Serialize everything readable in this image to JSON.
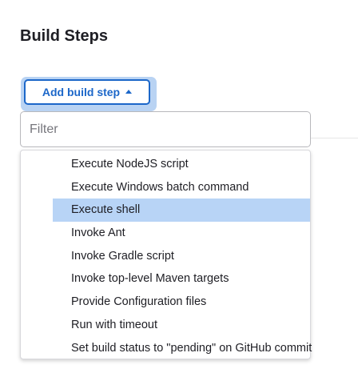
{
  "section": {
    "title": "Build Steps"
  },
  "add_step_button": {
    "label": "Add build step",
    "icon": "caret-up-icon"
  },
  "filter": {
    "placeholder": "Filter",
    "value": ""
  },
  "menu": {
    "highlighted_index": 2,
    "items": [
      {
        "label": "Execute NodeJS script"
      },
      {
        "label": "Execute Windows batch command"
      },
      {
        "label": "Execute shell"
      },
      {
        "label": "Invoke Ant"
      },
      {
        "label": "Invoke Gradle script"
      },
      {
        "label": "Invoke top-level Maven targets"
      },
      {
        "label": "Provide Configuration files"
      },
      {
        "label": "Run with timeout"
      },
      {
        "label": "Set build status to \"pending\" on GitHub commit"
      }
    ]
  },
  "colors": {
    "accent": "#1c67c9",
    "highlight": "#b8d4f6",
    "focus_ring": "#b9d3f3"
  }
}
